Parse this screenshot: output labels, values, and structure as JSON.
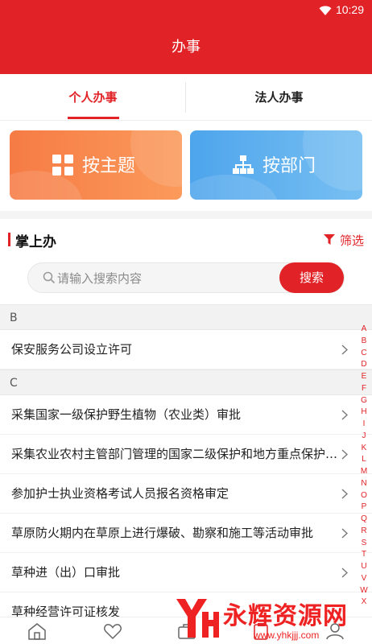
{
  "status": {
    "time": "10:29"
  },
  "header": {
    "title": "办事"
  },
  "tabs": [
    {
      "label": "个人办事",
      "active": true
    },
    {
      "label": "法人办事",
      "active": false
    }
  ],
  "cards": {
    "theme": {
      "label": "按主题",
      "icon": "grid-icon"
    },
    "dept": {
      "label": "按部门",
      "icon": "org-chart-icon"
    }
  },
  "section": {
    "title": "掌上办",
    "filter_label": "筛选"
  },
  "search": {
    "placeholder": "请输入搜索内容",
    "value": "",
    "button_label": "搜索"
  },
  "groups": [
    {
      "letter": "B",
      "items": [
        "保安服务公司设立许可"
      ]
    },
    {
      "letter": "C",
      "items": [
        "采集国家一级保护野生植物（农业类）审批",
        "采集农业农村主管部门管理的国家二级保护和地方重点保护野生植物审批",
        "参加护士执业资格考试人员报名资格审定",
        "草原防火期内在草原上进行爆破、勘察和施工等活动审批",
        "草种进（出）口审批",
        "草种经营许可证核发"
      ]
    }
  ],
  "index_letters": [
    "A",
    "B",
    "C",
    "D",
    "E",
    "F",
    "G",
    "H",
    "I",
    "J",
    "K",
    "L",
    "M",
    "N",
    "O",
    "P",
    "Q",
    "R",
    "S",
    "T",
    "U",
    "V",
    "W",
    "X"
  ],
  "bottom_nav": [
    "home-icon",
    "heart-icon",
    "briefcase-icon",
    "clipboard-icon",
    "user-icon"
  ],
  "watermark": {
    "title": "永辉资源网",
    "url": "www.yhkjjj.com"
  },
  "colors": {
    "brand_red": "#e12227",
    "theme_card": "#f67b45",
    "dept_card": "#4ea5ec"
  }
}
